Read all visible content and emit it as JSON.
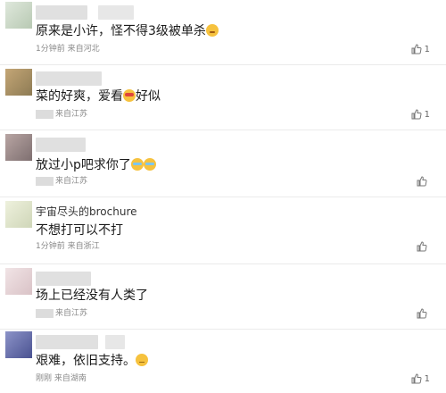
{
  "comments": [
    {
      "text": "原来是小许，怪不得3级被单杀",
      "emoji": "wink-emoji",
      "time": "1分钟前",
      "location": "来自河北",
      "likes": "1"
    },
    {
      "text": "菜的好爽，爱看",
      "emoji": "heart-eyes-emoji",
      "text_after": "好似",
      "location": "来自江苏",
      "likes": "1"
    },
    {
      "text": "放过小p吧求你了",
      "emoji": "crying-emoji",
      "location": "来自江苏",
      "likes": ""
    },
    {
      "username": "宇宙尽头的brochure",
      "text": "不想打可以不打",
      "time": "1分钟前",
      "location": "来自浙江",
      "likes": ""
    },
    {
      "text": "场上已经没有人类了",
      "location": "来自江苏",
      "likes": ""
    },
    {
      "text": "艰难，依旧支持。",
      "emoji": "speechless-emoji",
      "time": "刚刚",
      "location": "来自湖南",
      "likes": "1"
    }
  ],
  "colors": {
    "avatar_1": "#c9d8c5",
    "avatar_2": "#b59a6e",
    "avatar_3": "#9d8a88",
    "avatar_4": "#dfe4cc",
    "avatar_5": "#e8d6d8",
    "avatar_6": "#6f77b0"
  }
}
